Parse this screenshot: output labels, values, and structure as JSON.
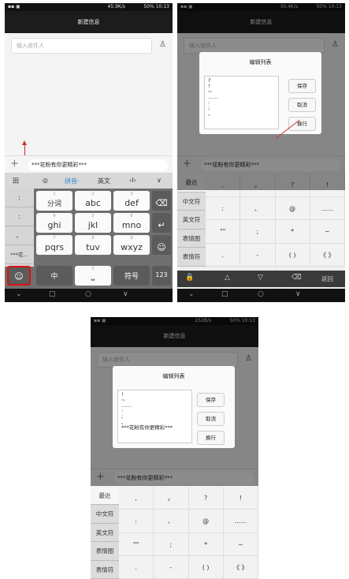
{
  "status": {
    "p1_speed": "45.9K/s",
    "p1_time": "50% 10:13",
    "p2_speed": "30.4K/s",
    "p2_time": "50% 10:13",
    "p3_speed": "252B/s",
    "p3_time": "50% 10:13"
  },
  "title": "新建信息",
  "recipient_placeholder": "输入收件人",
  "message_text": "***花粉有你更精彩***",
  "p1": {
    "toolbar": {
      "grid": "田",
      "mic": "◎",
      "pinyin": "拼音·",
      "english": "英文",
      "cursor": "‹I›",
      "collapse": "∨"
    },
    "candidates": [
      ";",
      ":",
      "、",
      "***花..."
    ],
    "rows": [
      [
        {
          "sub": "1",
          "main": "分词"
        },
        {
          "sub": "2",
          "main": "abc"
        },
        {
          "sub": "3",
          "main": "def"
        }
      ],
      [
        {
          "sub": "4",
          "main": "ghi"
        },
        {
          "sub": "5",
          "main": "jkl"
        },
        {
          "sub": "6",
          "main": "mno"
        }
      ],
      [
        {
          "sub": "7",
          "main": "pqrs"
        },
        {
          "sub": "8",
          "main": "tuv"
        },
        {
          "sub": "9",
          "main": "wxyz"
        }
      ]
    ],
    "side": [
      "⌫",
      "↵",
      "☺"
    ],
    "bottom": {
      "emoji": "☺",
      "zh": "中",
      "space": "0",
      "symbol": "符号",
      "num": "123"
    }
  },
  "dialog": {
    "title": "编辑列表",
    "save": "保存",
    "cancel": "取消",
    "newline": "换行",
    "p2_lines": "?\n!\n~\n……\n:\n;\n、",
    "p3_lines": "!\n~\n……\n:\n;\n、\n***花粉有你更精彩***"
  },
  "sym": {
    "cats": [
      "最近",
      "中文符",
      "英文符",
      "表情图",
      "表情符"
    ],
    "grid": [
      [
        ",",
        "。",
        "?",
        "!"
      ],
      [
        ":",
        "、",
        "@",
        "……"
      ],
      [
        "\"\"",
        ";",
        "*",
        "~"
      ],
      [
        ".",
        "-",
        "( )",
        "《 》"
      ]
    ],
    "bar": {
      "lock": "🔒",
      "up": "△",
      "down": "▽",
      "del": "⌫",
      "back": "返回"
    }
  },
  "nav": {
    "back": "⌄",
    "home": "□",
    "circle": "○",
    "down": "∨"
  }
}
